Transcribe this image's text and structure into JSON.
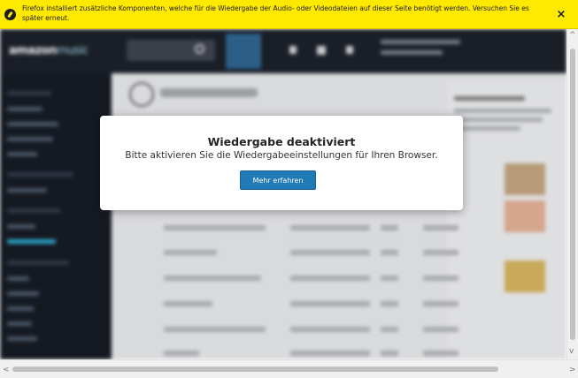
{
  "notification": {
    "message": "Firefox installiert zusätzliche Komponenten, welche für die Wiedergabe der Audio- oder Videodateien auf dieser Seite benötigt werden. Versuchen Sie es später erneut.",
    "close_glyph": "×",
    "icon": "firefox-puzzle-icon",
    "background_color": "#ffe900"
  },
  "dialog": {
    "title": "Wiedergabe deaktiviert",
    "message": "Bitte aktivieren Sie die Wiedergabeeinstellungen für Ihren Browser.",
    "button_label": "Mehr erfahren",
    "button_color": "#1f7ab5"
  },
  "background_app": {
    "logo_text": "amazon",
    "logo_suffix": "music",
    "accent_color": "#2ca3c7"
  },
  "scrollbars": {
    "up_glyph": "^",
    "down_glyph": "v",
    "left_glyph": "<",
    "right_glyph": ">"
  }
}
